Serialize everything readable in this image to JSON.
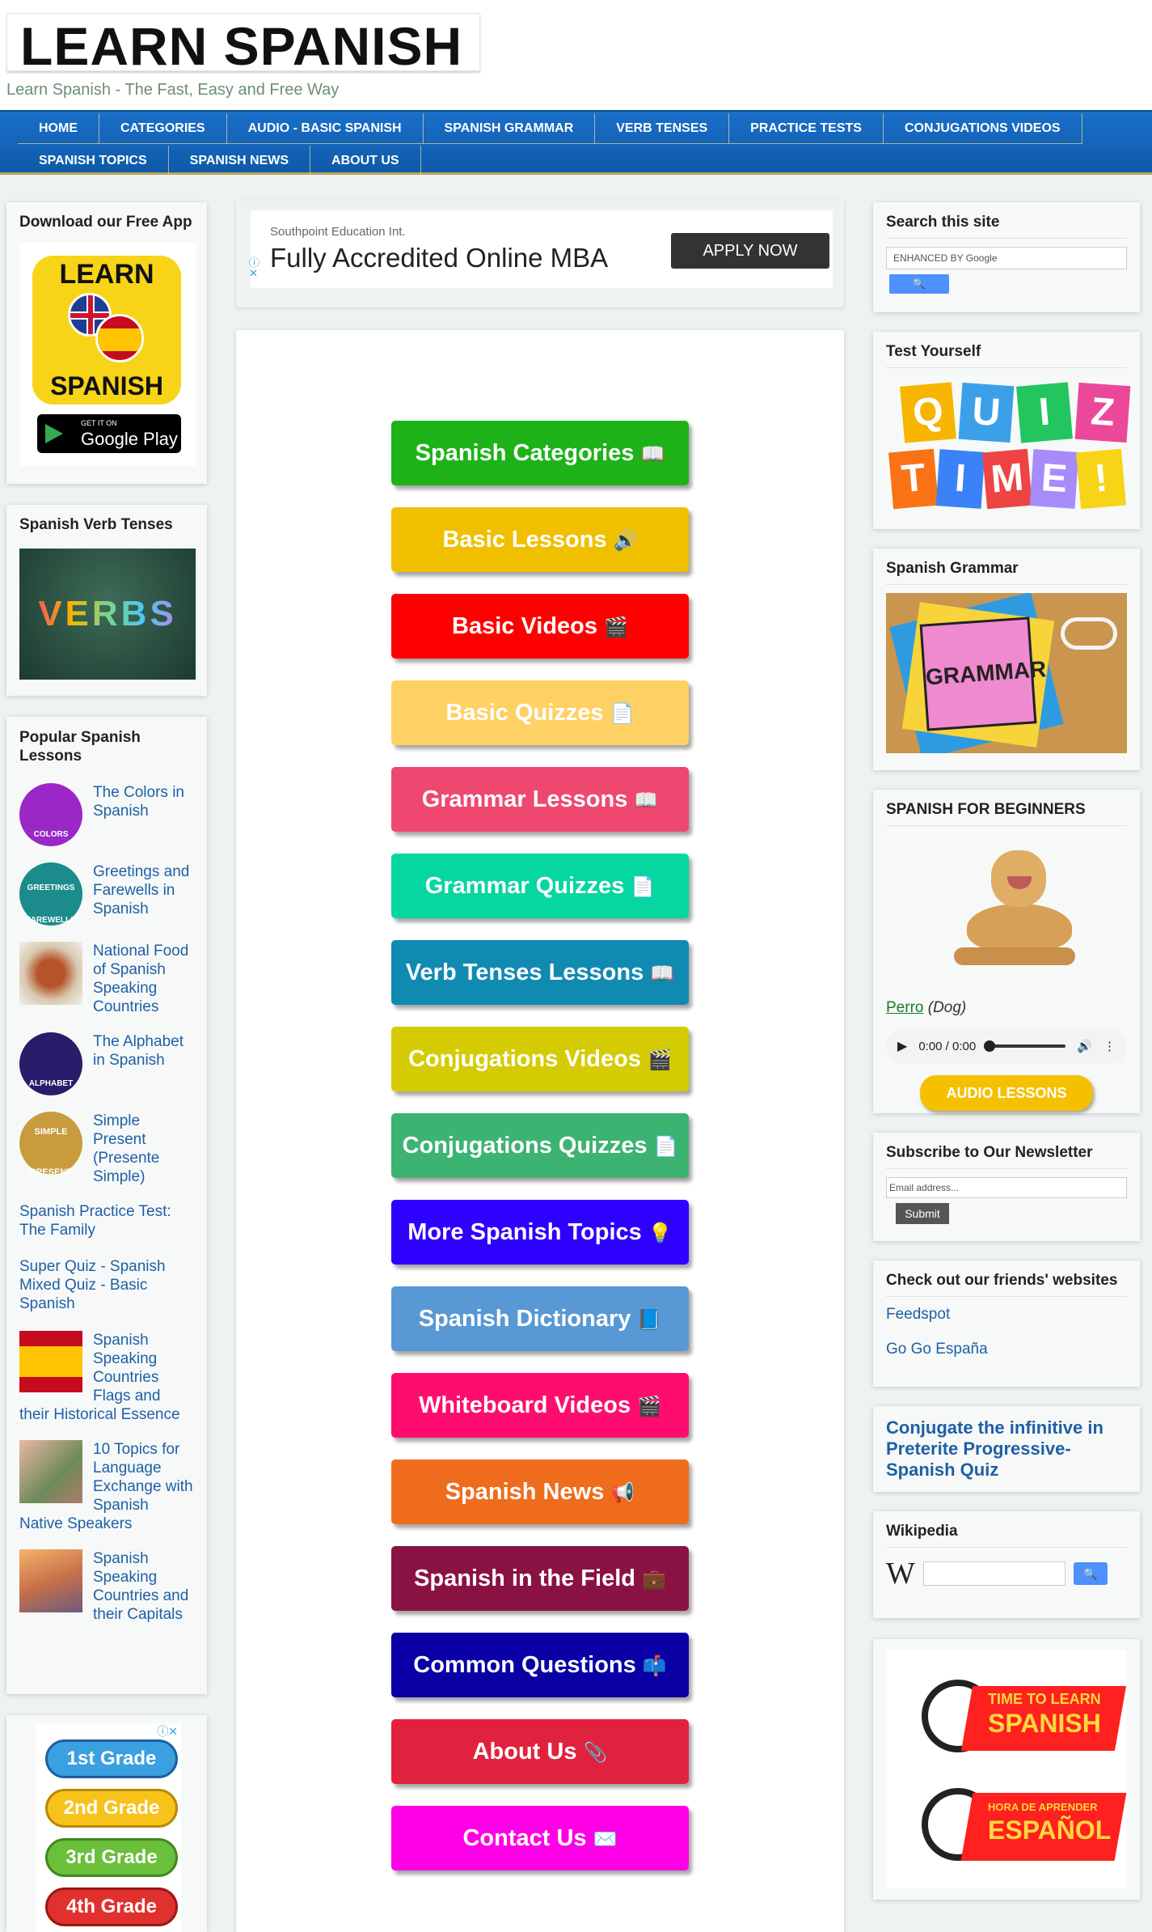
{
  "header": {
    "logo": "LEARN SPANISH",
    "tagline": "Learn Spanish - The Fast, Easy and Free Way"
  },
  "nav": {
    "row1": [
      "HOME",
      "CATEGORIES",
      "AUDIO - BASIC SPANISH",
      "SPANISH GRAMMAR",
      "VERB TENSES",
      "PRACTICE TESTS",
      "CONJUGATIONS VIDEOS"
    ],
    "row2": [
      "SPANISH TOPICS",
      "SPANISH NEWS",
      "ABOUT US"
    ]
  },
  "left": {
    "app": {
      "title": "Download our Free App",
      "logo_top": "LEARN",
      "logo_bottom": "SPANISH",
      "badge_small": "GET IT ON",
      "badge_big": "Google Play"
    },
    "verbs": {
      "title": "Spanish Verb Tenses",
      "image_text": "VERBS"
    },
    "popular": {
      "title": "Popular Spanish Lessons",
      "items": [
        {
          "text": "The Colors in Spanish",
          "thumb": "COLORS"
        },
        {
          "text": "Greetings and Farewells in Spanish",
          "thumb": "GREETINGS FAREWELLS"
        },
        {
          "text": "National Food of Spanish Speaking Countries",
          "thumb": ""
        },
        {
          "text": "The Alphabet in Spanish",
          "thumb": "ALPHABET"
        },
        {
          "text": "Simple Present (Presente Simple)",
          "thumb": "SIMPLE PRESENT"
        }
      ],
      "plain_links": [
        "Spanish Practice Test: The Family",
        "Super Quiz - Spanish Mixed Quiz - Basic Spanish"
      ],
      "items2": [
        {
          "text": "Spanish Speaking Countries Flags and their Historical Essence"
        },
        {
          "text": "10 Topics for Language Exchange with Spanish Native Speakers"
        },
        {
          "text": "Spanish Speaking Countries and their Capitals"
        }
      ]
    },
    "grades": [
      "1st Grade",
      "2nd Grade",
      "3rd Grade",
      "4th Grade"
    ]
  },
  "ad": {
    "source": "Southpoint Education Int.",
    "headline": "Fully Accredited Online MBA",
    "cta": "APPLY NOW"
  },
  "buttons": [
    {
      "label": "Spanish Categories",
      "emoji": "📖",
      "color": "#1db318"
    },
    {
      "label": "Basic Lessons",
      "emoji": "🔊",
      "color": "#f0bf00"
    },
    {
      "label": "Basic Videos",
      "emoji": "🎬",
      "color": "#ff0000"
    },
    {
      "label": "Basic Quizzes",
      "emoji": "📄",
      "color": "#ffd165"
    },
    {
      "label": "Grammar Lessons",
      "emoji": "📖",
      "color": "#ee4870"
    },
    {
      "label": "Grammar Quizzes",
      "emoji": "📄",
      "color": "#06d6a0"
    },
    {
      "label": "Verb Tenses Lessons",
      "emoji": "📖",
      "color": "#118ab2"
    },
    {
      "label": "Conjugations Videos",
      "emoji": "🎬",
      "color": "#d4cb03"
    },
    {
      "label": "Conjugations Quizzes",
      "emoji": "📄",
      "color": "#3cb371"
    },
    {
      "label": "More Spanish Topics",
      "emoji": "💡",
      "color": "#2e00ff"
    },
    {
      "label": "Spanish Dictionary",
      "emoji": "📘",
      "color": "#5898d4"
    },
    {
      "label": "Whiteboard Videos",
      "emoji": "🎬",
      "color": "#ff0d6e"
    },
    {
      "label": "Spanish News",
      "emoji": "📢",
      "color": "#ef6c1c"
    },
    {
      "label": "Spanish in the Field",
      "emoji": "💼",
      "color": "#8a1243"
    },
    {
      "label": "Common Questions",
      "emoji": "📫",
      "color": "#0a00a5"
    },
    {
      "label": "About Us",
      "emoji": "📎",
      "color": "#e0223e"
    },
    {
      "label": "Contact Us",
      "emoji": "✉️",
      "color": "#ff00e6"
    }
  ],
  "right": {
    "search": {
      "title": "Search this site",
      "placeholder": "ENHANCED BY Google"
    },
    "quiz": {
      "title": "Test Yourself",
      "letters": [
        "Q",
        "U",
        "I",
        "Z",
        "T",
        "I",
        "M",
        "E",
        "!"
      ]
    },
    "grammar": {
      "title": "Spanish Grammar",
      "image_text": "GRAMMAR"
    },
    "beginners": {
      "title": "SPANISH FOR BEGINNERS",
      "word": "Perro",
      "translation": "(Dog)",
      "time": "0:00 / 0:00",
      "button": "AUDIO LESSONS"
    },
    "newsletter": {
      "title": "Subscribe to Our Newsletter",
      "placeholder": "Email address...",
      "submit": "Submit"
    },
    "friends": {
      "title": "Check out our friends' websites",
      "links": [
        "Feedspot",
        "Go Go España"
      ]
    },
    "conjugate": {
      "text": "Conjugate the infinitive in Preterite Progressive- Spanish Quiz"
    },
    "wiki": {
      "title": "Wikipedia"
    },
    "promo": {
      "line1a": "TIME TO LEARN",
      "line1b": "SPANISH",
      "line2a": "HORA DE APRENDER",
      "line2b": "ESPAÑOL"
    }
  },
  "colors": {
    "nav_blue": "#1568c1",
    "link_blue": "#1f5fa6",
    "page_bg": "#eef3f2"
  }
}
